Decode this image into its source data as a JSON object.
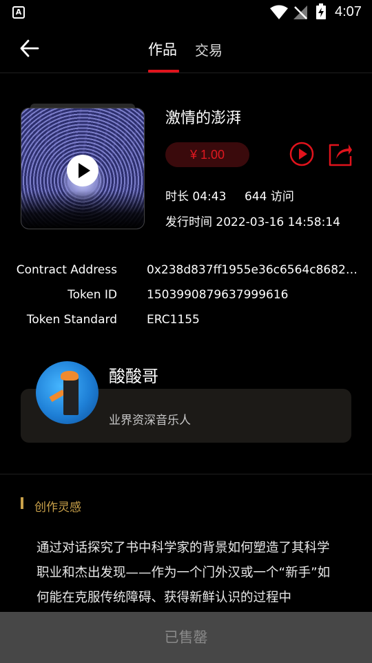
{
  "status_bar": {
    "time": "4:07",
    "app_icon": "A"
  },
  "nav": {
    "tabs": [
      {
        "label": "作品"
      },
      {
        "label": "交易"
      }
    ]
  },
  "song": {
    "title": "激情的澎湃",
    "price": "¥ 1.00",
    "duration": "时长 04:43",
    "visits": "644 访问",
    "release": "发行时间 2022-03-16 14:58:14"
  },
  "contract": {
    "address_label": "Contract Address",
    "address_value": "0x238d837ff1955e36c6564c86822e…",
    "token_id_label": "Token ID",
    "token_id_value": "1503990879637999616",
    "standard_label": "Token Standard",
    "standard_value": "ERC1155"
  },
  "artist": {
    "name": "酸酸哥",
    "description": "业界资深音乐人"
  },
  "inspiration": {
    "title": "创作灵感",
    "text": "通过对话探究了书中科学家的背景如何塑造了其科学职业和杰出发现——作为一个门外汉或一个“新手”如何能在克服传统障碍、获得新鲜认识的过程中"
  },
  "bottom": {
    "sold_label": "已售罄"
  },
  "colors": {
    "accent": "#e0131c",
    "gold": "#c9a14a",
    "price_bg": "#3a0a0c"
  }
}
